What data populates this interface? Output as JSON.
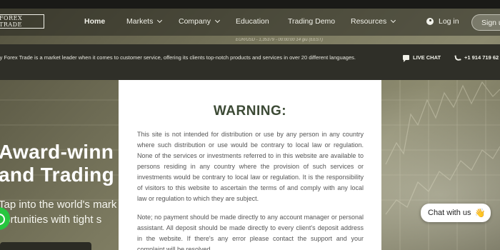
{
  "nav": {
    "logo": "FOREX TRADE",
    "items": [
      {
        "label": "Home",
        "active": true,
        "dropdown": false
      },
      {
        "label": "Markets",
        "active": false,
        "dropdown": true
      },
      {
        "label": "Company",
        "active": false,
        "dropdown": true
      },
      {
        "label": "Education",
        "active": false,
        "dropdown": false
      },
      {
        "label": "Trading Demo",
        "active": false,
        "dropdown": false
      },
      {
        "label": "Resources",
        "active": false,
        "dropdown": true
      }
    ],
    "login_label": "Log in",
    "signup_label": "Sign up"
  },
  "ticker_text": "EUR/USD - 1,35379 - 00:00:00 14 giu (EEST)",
  "info": {
    "text": "ly Forex Trade is a market leader when it comes to customer service, offering its clients top-notch products and services in over 20 different languages.",
    "live_chat_label": "LIVE CHAT",
    "phone_label": "+1 914 719 62"
  },
  "hero": {
    "heading_line1": "Award-winn",
    "heading_line2": "and Trading",
    "sub_line1": "Tap into the world's mark",
    "sub_line2": "portunities with tight s"
  },
  "modal": {
    "title": "WARNING:",
    "paragraph1": "This site is not intended for distribution or use by any person in any country where such distribution or use would be contrary to local law or regulation. None of the services or investments referred to in this website are available to persons residing in any country where the provision of such services or investments would be contrary to local law or regulation. It is the responsibility of visitors to this website to ascertain the terms of and comply with any local law or regulation to which they are subject.",
    "paragraph2": "Note; no payment should be made directly to any account manager or personal assistant. All deposit should be made directly to every client's deposit address in the website. If there's any error please contact the support and your complaint will be resolved."
  },
  "chat_widget": {
    "label": "Chat with us",
    "emoji": "👋"
  },
  "colors": {
    "modal_title": "#3c4a35",
    "info_bar": "#2f2f28",
    "whatsapp": "#27c63f"
  }
}
